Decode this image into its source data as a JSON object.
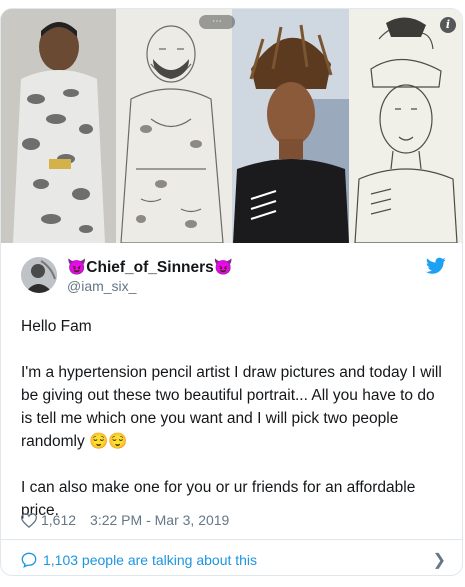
{
  "media": {
    "tag_label": "⋯",
    "info_glyph": "i",
    "panels": [
      "photo-man-camo",
      "drawing-man-camo",
      "photo-young-man-dreadlocks",
      "drawing-young-man"
    ]
  },
  "tweet": {
    "display_name": "😈Chief_of_Sinners😈",
    "handle": "@iam_six_",
    "paragraphs": [
      "Hello Fam",
      "I'm a hypertension pencil artist I draw pictures and today I will be giving out these two beautiful portrait... All you have to do is tell me which one you want and I will pick two people randomly 😌😌",
      "I can also make one for you or ur friends for an affordable price."
    ],
    "likes": "1,612",
    "timestamp": "3:22 PM - Mar 3, 2019",
    "talking_label": "1,103 people are talking about this"
  },
  "colors": {
    "link": "#1b95e0",
    "muted": "#657786",
    "twitter_blue": "#1da1f2",
    "border": "#e1e8ed"
  },
  "icons": [
    "heart-icon",
    "comment-icon",
    "twitter-bird-icon",
    "chevron-right-icon",
    "info-icon"
  ]
}
